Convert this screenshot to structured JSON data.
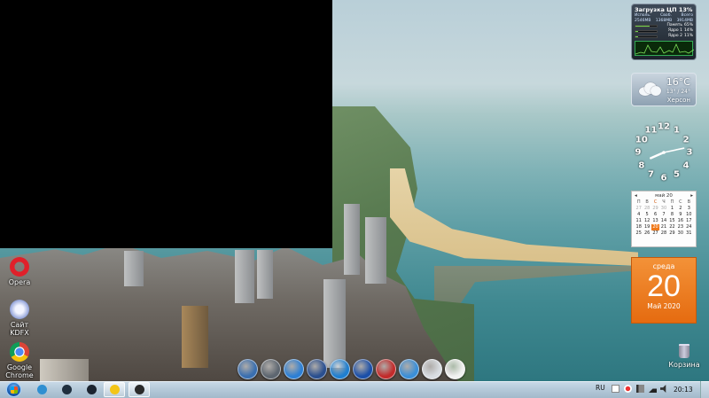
{
  "desktop": {
    "icons": [
      {
        "label": "Opera",
        "icon": "opera-icon",
        "color": "#e0202a"
      },
      {
        "label": "Сайт KDFX",
        "icon": "kdfx-site-icon",
        "color": "#d8dcef"
      },
      {
        "label": "Google Chrome",
        "icon": "chrome-icon",
        "color": "#f3c517"
      }
    ],
    "recycle_bin": {
      "label": "Корзина"
    }
  },
  "gadgets": {
    "cpu": {
      "title": "Загрузка ЦП  13%",
      "headers": [
        "Исполь.",
        "Своб.",
        "Всего"
      ],
      "values": [
        "2546MB",
        "1368MB",
        "3914MB"
      ],
      "rows": [
        {
          "label": "Память",
          "value": "65%",
          "percent": 65
        },
        {
          "label": "Ядро 1",
          "value": "14%",
          "percent": 14
        },
        {
          "label": "Ядро 2",
          "value": "11%",
          "percent": 11
        }
      ]
    },
    "weather": {
      "temp": "16°C",
      "range": "13° / 24°",
      "city": "Херсон"
    },
    "clock": {
      "numerals": [
        "12",
        "1",
        "2",
        "3",
        "4",
        "5",
        "6",
        "7",
        "8",
        "9",
        "10",
        "11"
      ],
      "hour": 8,
      "minute": 13
    },
    "calendar": {
      "month_label": "май 20",
      "weekdays": [
        "П",
        "В",
        "С",
        "Ч",
        "П",
        "С",
        "В"
      ],
      "weeks": [
        [
          "27",
          "28",
          "29",
          "30",
          "1",
          "2",
          "3"
        ],
        [
          "4",
          "5",
          "6",
          "7",
          "8",
          "9",
          "10"
        ],
        [
          "11",
          "12",
          "13",
          "14",
          "15",
          "16",
          "17"
        ],
        [
          "18",
          "19",
          "20",
          "21",
          "22",
          "23",
          "24"
        ],
        [
          "25",
          "26",
          "27",
          "28",
          "29",
          "30",
          "31"
        ]
      ],
      "today": "20"
    },
    "day_card": {
      "weekday": "среда",
      "day": "20",
      "month_year": "Май 2020"
    }
  },
  "dock": {
    "items": [
      {
        "icon": "dock-app-1-icon",
        "color": "#3a6fb0"
      },
      {
        "icon": "dock-calculator-icon",
        "color": "#5d6670"
      },
      {
        "icon": "dock-monitor-icon",
        "color": "#2d7fd4"
      },
      {
        "icon": "dock-tools-icon",
        "color": "#2a4f8f"
      },
      {
        "icon": "dock-media-player-icon",
        "color": "#1f7fd0"
      },
      {
        "icon": "dock-play-icon",
        "color": "#1b4fa8"
      },
      {
        "icon": "dock-speedometer-icon",
        "color": "#c22b2b"
      },
      {
        "icon": "dock-windows-icon",
        "color": "#3b8fd8"
      },
      {
        "icon": "dock-mouse-icon",
        "color": "#d9dde2"
      },
      {
        "icon": "dock-cards-icon",
        "color": "#f1f1f1"
      }
    ]
  },
  "taskbar": {
    "buttons": [
      {
        "icon": "pinned-app-1-icon",
        "color": "#2f8fd1",
        "active": false
      },
      {
        "icon": "pinned-app-2-icon",
        "color": "#1f2f3f",
        "active": false
      },
      {
        "icon": "pinned-app-3-icon",
        "color": "#1b2430",
        "active": false
      },
      {
        "icon": "chrome-taskbar-icon",
        "color": "#f3c517",
        "active": true
      },
      {
        "icon": "pinned-app-5-icon",
        "color": "#2a2a2a",
        "active": true
      }
    ],
    "language": "RU",
    "time": "20:13",
    "colors": {
      "accent": "#f07a1c"
    }
  }
}
